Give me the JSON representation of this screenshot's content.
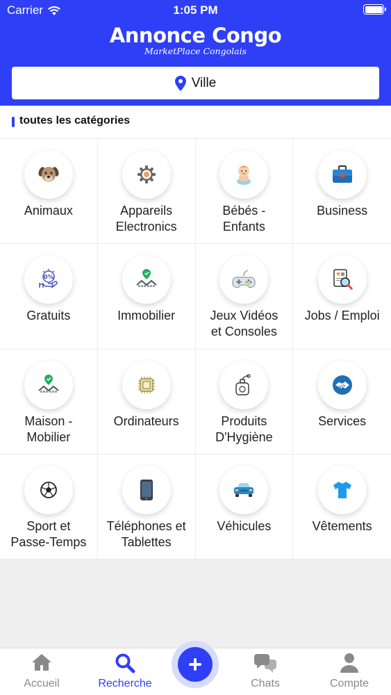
{
  "status_bar": {
    "carrier": "Carrier",
    "time": "1:05 PM"
  },
  "header": {
    "title": "Annonce Congo",
    "subtitle": "MarketPlace Congolais",
    "city_button_label": "Ville"
  },
  "section": {
    "title": "toutes les catégories"
  },
  "categories": [
    {
      "label": "Animaux",
      "icon": "dog-icon"
    },
    {
      "label": "Appareils\nElectronics",
      "icon": "gear-icon"
    },
    {
      "label": "Bébés -\nEnfants",
      "icon": "baby-icon"
    },
    {
      "label": "Business",
      "icon": "briefcase-icon"
    },
    {
      "label": "Gratuits",
      "icon": "discount-hand-icon"
    },
    {
      "label": "Immobilier",
      "icon": "location-houses-icon"
    },
    {
      "label": "Jeux Vidéos\net Consoles",
      "icon": "gamepad-icon"
    },
    {
      "label": "Jobs / Emploi",
      "icon": "resume-search-icon"
    },
    {
      "label": "Maison -\nMobilier",
      "icon": "location-houses-icon"
    },
    {
      "label": "Ordinateurs",
      "icon": "computer-chip-icon"
    },
    {
      "label": "Produits\nD'Hygiène",
      "icon": "perfume-bottle-icon"
    },
    {
      "label": "Services",
      "icon": "handshake-icon"
    },
    {
      "label": "Sport et\nPasse-Temps",
      "icon": "soccer-ball-icon"
    },
    {
      "label": "Téléphones et\nTablettes",
      "icon": "smartphone-icon"
    },
    {
      "label": "Véhicules",
      "icon": "car-icon"
    },
    {
      "label": "Vêtements",
      "icon": "tshirt-icon"
    }
  ],
  "tabbar": {
    "items": [
      {
        "label": "Accueil",
        "icon": "home-icon"
      },
      {
        "label": "Recherche",
        "icon": "search-icon",
        "active": true
      },
      {
        "label": "Chats",
        "icon": "chat-bubbles-icon"
      },
      {
        "label": "Compte",
        "icon": "user-icon"
      }
    ],
    "fab_icon": "plus-icon"
  },
  "colors": {
    "brand": "#2f3ff5",
    "active_tab": "#2f3ff5",
    "inactive_tab": "#8a8a8a"
  }
}
